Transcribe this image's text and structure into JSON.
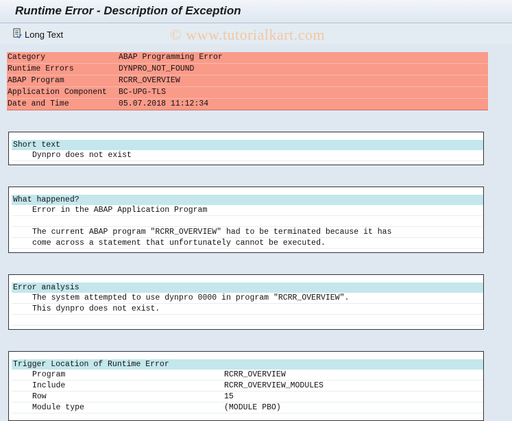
{
  "window": {
    "title": "Runtime Error - Description of Exception"
  },
  "toolbar": {
    "long_text_label": "Long Text"
  },
  "watermark": "© www.tutorialkart.com",
  "header": [
    {
      "key": "Category",
      "value": "ABAP Programming Error"
    },
    {
      "key": "Runtime Errors",
      "value": "DYNPRO_NOT_FOUND"
    },
    {
      "key": "ABAP Program",
      "value": "RCRR_OVERVIEW"
    },
    {
      "key": "Application Component",
      "value": "BC-UPG-TLS"
    },
    {
      "key": "Date and Time",
      "value": "05.07.2018 11:12:34"
    }
  ],
  "short_text": {
    "title": "Short text",
    "lines": [
      "Dynpro does not exist"
    ]
  },
  "what_happened": {
    "title": "What happened?",
    "lines": [
      "Error in the ABAP Application Program",
      "",
      "The current ABAP program \"RCRR_OVERVIEW\" had to be terminated because it has",
      "come across a statement that unfortunately cannot be executed."
    ]
  },
  "error_analysis": {
    "title": "Error analysis",
    "lines": [
      "The system attempted to use dynpro 0000 in program \"RCRR_OVERVIEW\".",
      "This dynpro does not exist.",
      ""
    ]
  },
  "trigger_location": {
    "title": "Trigger Location of Runtime Error",
    "rows": [
      {
        "key": "Program",
        "value": "RCRR_OVERVIEW"
      },
      {
        "key": "Include",
        "value": "RCRR_OVERVIEW_MODULES"
      },
      {
        "key": "Row",
        "value": "15"
      },
      {
        "key": "Module type",
        "value": "(MODULE PBO)"
      }
    ]
  }
}
